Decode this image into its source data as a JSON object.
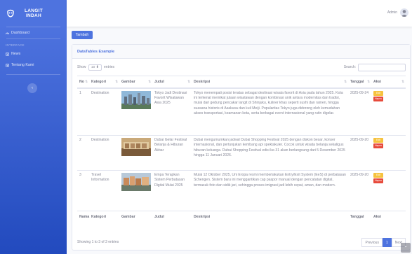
{
  "brand": {
    "line1": "LANGIT",
    "line2": "INDAH"
  },
  "sidebar": {
    "items": [
      {
        "label": "Dashboard",
        "icon": "tachometer-icon"
      },
      {
        "label": "News",
        "icon": "table-icon"
      },
      {
        "label": "Tentang Kami",
        "icon": "table-icon"
      }
    ],
    "heading": "INTERFACE"
  },
  "topbar": {
    "user_name": "Admin"
  },
  "add_button": "Tambah",
  "card": {
    "title": "DataTables Example"
  },
  "controls": {
    "show": "Show",
    "entries_value": "10",
    "entries": "entries",
    "search_label": "Search:"
  },
  "table": {
    "headers": [
      "No",
      "Kategori",
      "Gambar",
      "Judul",
      "Deskripsi",
      "Tanggal",
      "Aksi"
    ],
    "footers": [
      "Nama",
      "Kategori",
      "Gambar",
      "Judul",
      "Deskripsi",
      "Tanggal",
      "Aksi"
    ],
    "rows": [
      {
        "no": "1",
        "kategori": "Destination",
        "judul": "Tokyo Jadi Destinasi Favorit Wisatawan Asia 2025",
        "deskripsi": "Tokyo menempati posisi teratas sebagai destinasi wisata favorit di Asia pada tahun 2025. Kota ini terkenal memikat jutaan wisatawan dengan kombinasi unik antara modernitas dan tradisi, mulai dari gedung pencakar langit di Shinjuku, kuliner khas seperti sushi dan ramen, hingga suasana historis di Asakusa dan kuil Meiji. Popularitas Tokyo juga didorong oleh kemudahan akses transportasi, keamanan kota, serta berbagai event internasional yang rutin digelar.",
        "tanggal": "2025-09-24",
        "edit": "Edit",
        "hapus": "Hapus"
      },
      {
        "no": "2",
        "kategori": "Destination",
        "judul": "Dubai Gelar Festival Belanja & Hiburan Akbar",
        "deskripsi": "Dubai mengumumkan jadwal Dubai Shopping Festival 2025 dengan diskon besar, konser internasional, dan pertunjukan kembang api spektakuler. Cocok untuk wisata belanja sekaligus hiburan keluarga. Dubai Shopping Festival edisi ke-31 akan berlangsung dari 5 Desember 2025 hingga 11 Januari 2026.",
        "tanggal": "2025-09-20",
        "edit": "Edit",
        "hapus": "Hapus"
      },
      {
        "no": "3",
        "kategori": "Travel Information",
        "judul": "Empa Terapkan Sistem Perbatasan Digital Mulai 2025",
        "deskripsi": "Mulai 12 Oktober 2025, Uni Eropa resmi memberlakukan Entry/Exit System (EeS) di perbatasan Schengen. Sistem baru ini menggantikan cap paspor manual dengan pencatatan digital, termasuk foto dan sidik jari, sehingga proses imigrasi jadi lebih cepat, aman, dan modern.",
        "tanggal": "2025-09-20",
        "edit": "Edit",
        "hapus": "Hapus"
      }
    ]
  },
  "footer": {
    "info": "Showing 1 to 3 of 3 entries",
    "previous": "Previous",
    "page": "1",
    "next": "Next"
  },
  "colors": {
    "primary": "#4e73df",
    "warning": "#f6c23e",
    "danger": "#e74a3b"
  }
}
